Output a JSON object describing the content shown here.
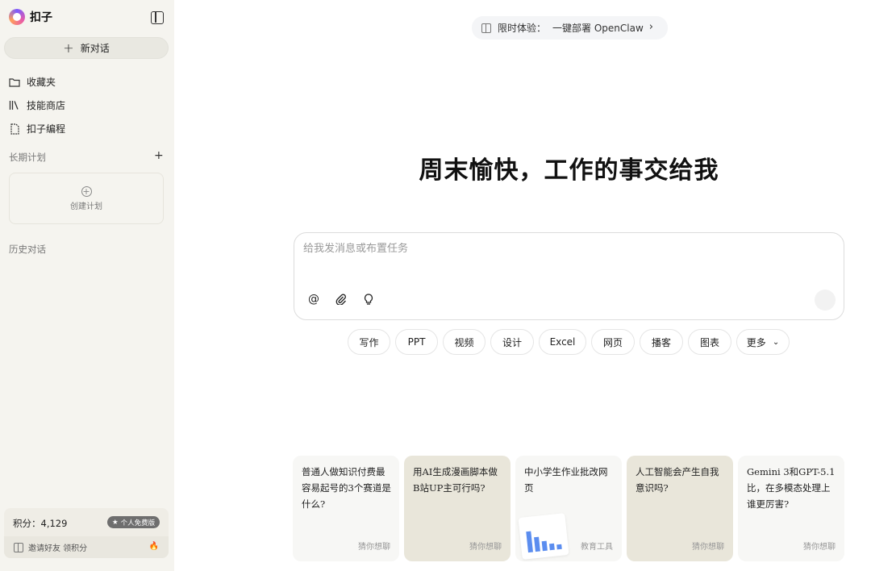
{
  "sidebar": {
    "brand": "扣子",
    "new_chat": "新对话",
    "items": [
      {
        "label": "收藏夹",
        "icon": "folder-icon"
      },
      {
        "label": "技能商店",
        "icon": "books-icon"
      },
      {
        "label": "扣子编程",
        "icon": "code-file-icon"
      }
    ],
    "long_term_plan_label": "长期计划",
    "create_plan_label": "创建计划",
    "history_label": "历史对话",
    "points_label": "积分：",
    "points_value": "4,129",
    "badge_label": "个人免费版",
    "invite_label": "邀请好友 领积分"
  },
  "promo": {
    "label": "限时体验：",
    "text": "一键部署 OpenClaw"
  },
  "hero_title": "周末愉快，工作的事交给我",
  "composer": {
    "placeholder": "给我发消息或布置任务",
    "tools": [
      "at-icon",
      "paperclip-icon",
      "lightbulb-icon"
    ]
  },
  "chips": [
    "写作",
    "PPT",
    "视频",
    "设计",
    "Excel",
    "网页",
    "播客",
    "图表",
    "更多"
  ],
  "cards": [
    {
      "text": "普通人做知识付费最容易起号的3个赛道是什么?",
      "tag": "猜你想聊"
    },
    {
      "text": "用AI生成漫画脚本做B站UP主可行吗?",
      "tag": "猜你想聊"
    },
    {
      "text": "中小学生作业批改网页",
      "tag": "教育工具"
    },
    {
      "text": "人工智能会产生自我意识吗?",
      "tag": "猜你想聊"
    },
    {
      "text": "Gemini 3和GPT-5.1比，在多模态处理上谁更厉害?",
      "tag": "猜你想聊"
    }
  ]
}
